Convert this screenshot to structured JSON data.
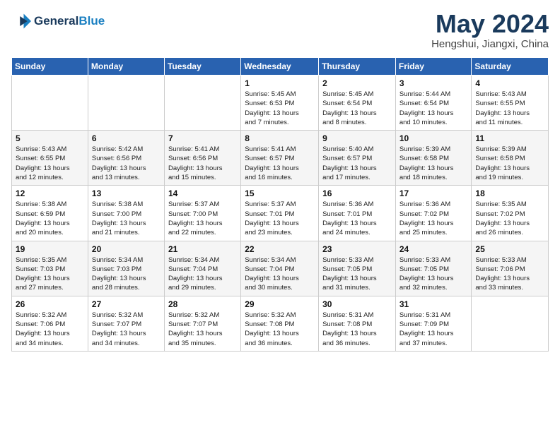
{
  "logo": {
    "line1": "General",
    "line2": "Blue"
  },
  "title": "May 2024",
  "subtitle": "Hengshui, Jiangxi, China",
  "weekdays": [
    "Sunday",
    "Monday",
    "Tuesday",
    "Wednesday",
    "Thursday",
    "Friday",
    "Saturday"
  ],
  "weeks": [
    [
      {
        "num": "",
        "info": ""
      },
      {
        "num": "",
        "info": ""
      },
      {
        "num": "",
        "info": ""
      },
      {
        "num": "1",
        "info": "Sunrise: 5:45 AM\nSunset: 6:53 PM\nDaylight: 13 hours\nand 7 minutes."
      },
      {
        "num": "2",
        "info": "Sunrise: 5:45 AM\nSunset: 6:54 PM\nDaylight: 13 hours\nand 8 minutes."
      },
      {
        "num": "3",
        "info": "Sunrise: 5:44 AM\nSunset: 6:54 PM\nDaylight: 13 hours\nand 10 minutes."
      },
      {
        "num": "4",
        "info": "Sunrise: 5:43 AM\nSunset: 6:55 PM\nDaylight: 13 hours\nand 11 minutes."
      }
    ],
    [
      {
        "num": "5",
        "info": "Sunrise: 5:43 AM\nSunset: 6:55 PM\nDaylight: 13 hours\nand 12 minutes."
      },
      {
        "num": "6",
        "info": "Sunrise: 5:42 AM\nSunset: 6:56 PM\nDaylight: 13 hours\nand 13 minutes."
      },
      {
        "num": "7",
        "info": "Sunrise: 5:41 AM\nSunset: 6:56 PM\nDaylight: 13 hours\nand 15 minutes."
      },
      {
        "num": "8",
        "info": "Sunrise: 5:41 AM\nSunset: 6:57 PM\nDaylight: 13 hours\nand 16 minutes."
      },
      {
        "num": "9",
        "info": "Sunrise: 5:40 AM\nSunset: 6:57 PM\nDaylight: 13 hours\nand 17 minutes."
      },
      {
        "num": "10",
        "info": "Sunrise: 5:39 AM\nSunset: 6:58 PM\nDaylight: 13 hours\nand 18 minutes."
      },
      {
        "num": "11",
        "info": "Sunrise: 5:39 AM\nSunset: 6:58 PM\nDaylight: 13 hours\nand 19 minutes."
      }
    ],
    [
      {
        "num": "12",
        "info": "Sunrise: 5:38 AM\nSunset: 6:59 PM\nDaylight: 13 hours\nand 20 minutes."
      },
      {
        "num": "13",
        "info": "Sunrise: 5:38 AM\nSunset: 7:00 PM\nDaylight: 13 hours\nand 21 minutes."
      },
      {
        "num": "14",
        "info": "Sunrise: 5:37 AM\nSunset: 7:00 PM\nDaylight: 13 hours\nand 22 minutes."
      },
      {
        "num": "15",
        "info": "Sunrise: 5:37 AM\nSunset: 7:01 PM\nDaylight: 13 hours\nand 23 minutes."
      },
      {
        "num": "16",
        "info": "Sunrise: 5:36 AM\nSunset: 7:01 PM\nDaylight: 13 hours\nand 24 minutes."
      },
      {
        "num": "17",
        "info": "Sunrise: 5:36 AM\nSunset: 7:02 PM\nDaylight: 13 hours\nand 25 minutes."
      },
      {
        "num": "18",
        "info": "Sunrise: 5:35 AM\nSunset: 7:02 PM\nDaylight: 13 hours\nand 26 minutes."
      }
    ],
    [
      {
        "num": "19",
        "info": "Sunrise: 5:35 AM\nSunset: 7:03 PM\nDaylight: 13 hours\nand 27 minutes."
      },
      {
        "num": "20",
        "info": "Sunrise: 5:34 AM\nSunset: 7:03 PM\nDaylight: 13 hours\nand 28 minutes."
      },
      {
        "num": "21",
        "info": "Sunrise: 5:34 AM\nSunset: 7:04 PM\nDaylight: 13 hours\nand 29 minutes."
      },
      {
        "num": "22",
        "info": "Sunrise: 5:34 AM\nSunset: 7:04 PM\nDaylight: 13 hours\nand 30 minutes."
      },
      {
        "num": "23",
        "info": "Sunrise: 5:33 AM\nSunset: 7:05 PM\nDaylight: 13 hours\nand 31 minutes."
      },
      {
        "num": "24",
        "info": "Sunrise: 5:33 AM\nSunset: 7:05 PM\nDaylight: 13 hours\nand 32 minutes."
      },
      {
        "num": "25",
        "info": "Sunrise: 5:33 AM\nSunset: 7:06 PM\nDaylight: 13 hours\nand 33 minutes."
      }
    ],
    [
      {
        "num": "26",
        "info": "Sunrise: 5:32 AM\nSunset: 7:06 PM\nDaylight: 13 hours\nand 34 minutes."
      },
      {
        "num": "27",
        "info": "Sunrise: 5:32 AM\nSunset: 7:07 PM\nDaylight: 13 hours\nand 34 minutes."
      },
      {
        "num": "28",
        "info": "Sunrise: 5:32 AM\nSunset: 7:07 PM\nDaylight: 13 hours\nand 35 minutes."
      },
      {
        "num": "29",
        "info": "Sunrise: 5:32 AM\nSunset: 7:08 PM\nDaylight: 13 hours\nand 36 minutes."
      },
      {
        "num": "30",
        "info": "Sunrise: 5:31 AM\nSunset: 7:08 PM\nDaylight: 13 hours\nand 36 minutes."
      },
      {
        "num": "31",
        "info": "Sunrise: 5:31 AM\nSunset: 7:09 PM\nDaylight: 13 hours\nand 37 minutes."
      },
      {
        "num": "",
        "info": ""
      }
    ]
  ]
}
